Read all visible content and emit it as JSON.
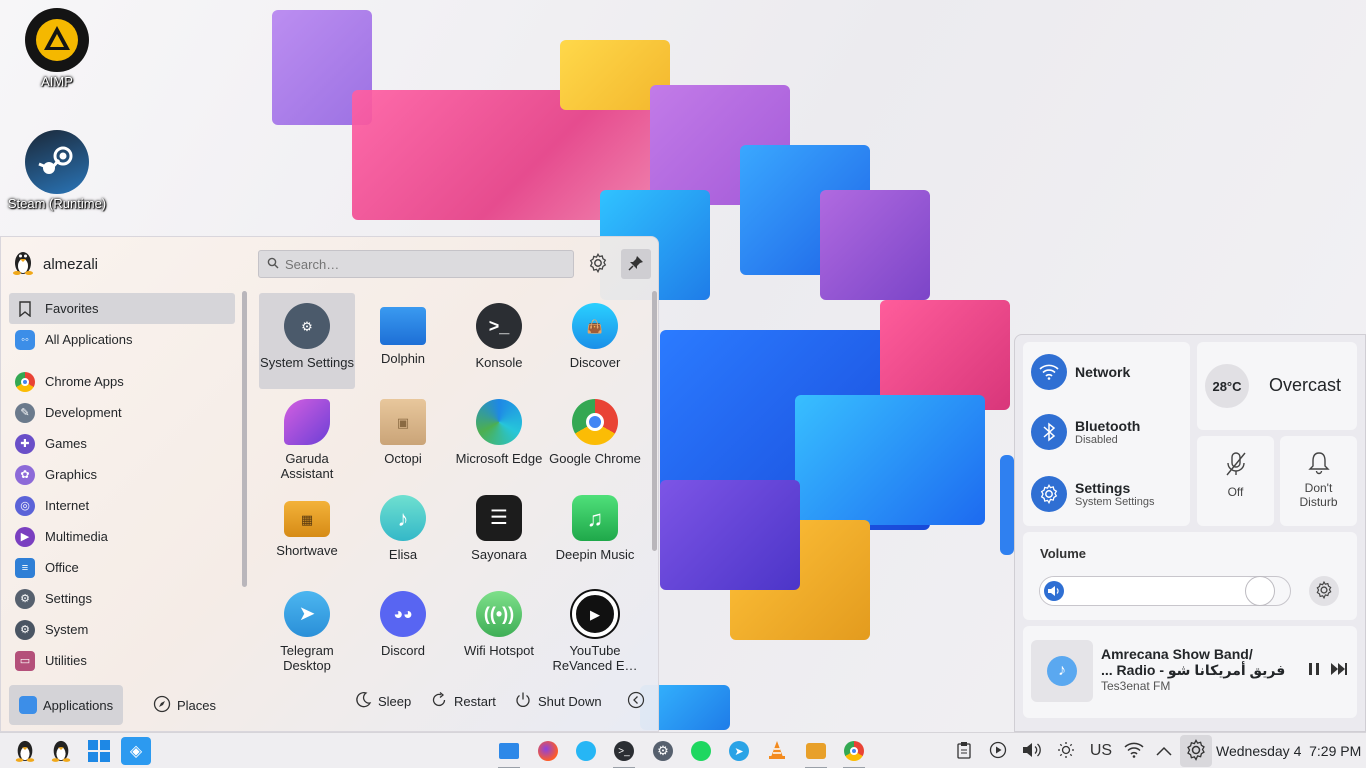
{
  "desktop": {
    "icons": [
      {
        "label": "AIMP",
        "icon": "aimp-icon"
      },
      {
        "label": "Steam (Runtime)",
        "icon": "steam-icon"
      }
    ]
  },
  "launcher": {
    "user": "almezali",
    "search_placeholder": "Search…",
    "categories": [
      "Favorites",
      "All Applications",
      "Chrome Apps",
      "Development",
      "Games",
      "Graphics",
      "Internet",
      "Multimedia",
      "Office",
      "Settings",
      "System",
      "Utilities"
    ],
    "apps": [
      "System Settings",
      "Dolphin",
      "Konsole",
      "Discover",
      "Garuda Assistant",
      "Octopi",
      "Microsoft Edge",
      "Google Chrome",
      "Shortwave",
      "Elisa",
      "Sayonara",
      "Deepin Music",
      "Telegram Desktop",
      "Discord",
      "Wifi Hotspot",
      "YouTube ReVanced E…"
    ],
    "footer": {
      "applications": "Applications",
      "places": "Places",
      "sleep": "Sleep",
      "restart": "Restart",
      "shutdown": "Shut Down"
    }
  },
  "tray": {
    "network": {
      "title": "Network"
    },
    "bluetooth": {
      "title": "Bluetooth",
      "status": "Disabled"
    },
    "settings": {
      "title": "Settings",
      "subtitle": "System Settings"
    },
    "weather": {
      "temp": "28°C",
      "condition": "Overcast"
    },
    "mic": {
      "label": "Off"
    },
    "dnd": {
      "label": "Don't Disturb"
    },
    "volume": {
      "label": "Volume",
      "level": 0.93
    },
    "media": {
      "title_line1": "Amrecana Show Band/",
      "title_line2": "... Radio - فريق أمريكانا شو",
      "artist": "Tes3enat FM"
    }
  },
  "taskbar": {
    "keyboard_layout": "US",
    "clock": "Wednesday 4  7:29 PM"
  },
  "colors": {
    "accent": "#2f6fd3",
    "panel": "#efeef1"
  }
}
